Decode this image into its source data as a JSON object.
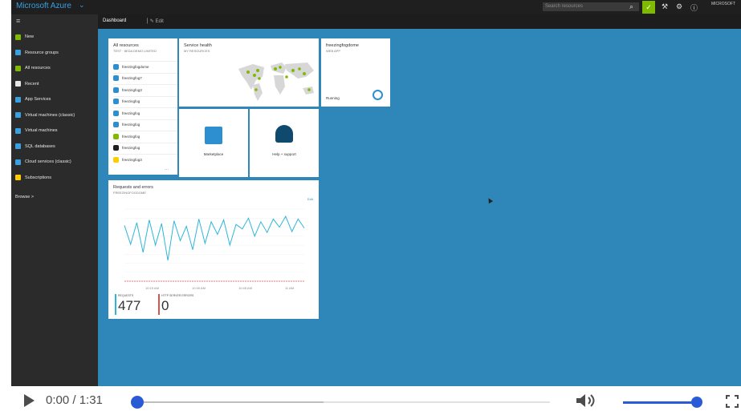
{
  "topbar": {
    "brand": "Microsoft Azure",
    "search_placeholder": "Search resources",
    "user": "MICROSOFT"
  },
  "header": {
    "dashboard": "Dashboard",
    "edit": "Edit"
  },
  "sidebar": {
    "items": [
      {
        "label": "New",
        "icon": "plus-icon",
        "color": "#7fba00"
      },
      {
        "label": "Resource groups",
        "icon": "resource-groups-icon",
        "color": "#3aa0e0"
      },
      {
        "label": "All resources",
        "icon": "grid-icon",
        "color": "#7fba00"
      },
      {
        "label": "Recent",
        "icon": "clock-icon",
        "color": "#e6e6e6"
      },
      {
        "label": "App Services",
        "icon": "globe-icon",
        "color": "#3aa0e0"
      },
      {
        "label": "Virtual machines (classic)",
        "icon": "vm-classic-icon",
        "color": "#3aa0e0"
      },
      {
        "label": "Virtual machines",
        "icon": "vm-icon",
        "color": "#3aa0e0"
      },
      {
        "label": "SQL databases",
        "icon": "database-icon",
        "color": "#3aa0e0"
      },
      {
        "label": "Cloud services (classic)",
        "icon": "cloud-icon",
        "color": "#3aa0e0"
      },
      {
        "label": "Subscriptions",
        "icon": "key-icon",
        "color": "#ffcc00"
      }
    ],
    "browse": "Browse >"
  },
  "all_resources": {
    "title": "All resources",
    "subtitle": "TEST · 8EDA DEMO LIMITED",
    "rows": [
      "freezingfogdome",
      "freezingfog7",
      "freezingfog3",
      "freezingfog",
      "freezingfog",
      "freezingfog",
      "freezingfog",
      "freezingfog",
      "freezingfog3"
    ],
    "more": "..."
  },
  "service_health": {
    "title": "Service health",
    "subtitle": "MY RESOURCES"
  },
  "webapp": {
    "title": "freezingfogdome",
    "subtitle": "WEB APP",
    "status": "Running"
  },
  "marketplace": {
    "label": "Marketplace"
  },
  "help": {
    "label": "Help + support"
  },
  "requests_chart": {
    "title": "Requests and errors",
    "subtitle": "FREEZINGFOGDOME",
    "edit": "Edit",
    "x_ticks": [
      "10:15 AM",
      "10:30 AM",
      "10:45 AM",
      "11 AM"
    ],
    "requests_label": "REQUESTS",
    "requests_value": "477",
    "errors_label": "HTTP SERVER ERRORS",
    "errors_value": "0",
    "color_requests": "#2fb6d8",
    "color_errors": "#d9534f"
  },
  "chart_data": {
    "type": "line",
    "title": "Requests and errors",
    "x": [
      "10:15 AM",
      "10:30 AM",
      "10:45 AM",
      "11 AM"
    ],
    "series": [
      {
        "name": "REQUESTS",
        "values": [
          6.2,
          4.1,
          6.5,
          3.2,
          6.8,
          4.0,
          6.4,
          2.3,
          6.7,
          4.5,
          6.1,
          3.5,
          6.9,
          4.2,
          6.6,
          5.2,
          6.8,
          4.0,
          6.3,
          5.8,
          7.0,
          5.0,
          6.6,
          5.4,
          6.9,
          6.0,
          7.2,
          5.5,
          6.9,
          5.9
        ]
      },
      {
        "name": "HTTP SERVER ERRORS",
        "values": [
          0,
          0,
          0,
          0,
          0,
          0,
          0,
          0,
          0,
          0,
          0,
          0,
          0,
          0,
          0,
          0,
          0,
          0,
          0,
          0,
          0,
          0,
          0,
          0,
          0,
          0,
          0,
          0,
          0,
          0
        ]
      }
    ],
    "ylim": [
      0,
      8
    ],
    "grid": true
  },
  "player": {
    "time": "0:00 / 1:31",
    "progress": 0.0,
    "buffered": 0.45,
    "volume": 0.95
  }
}
